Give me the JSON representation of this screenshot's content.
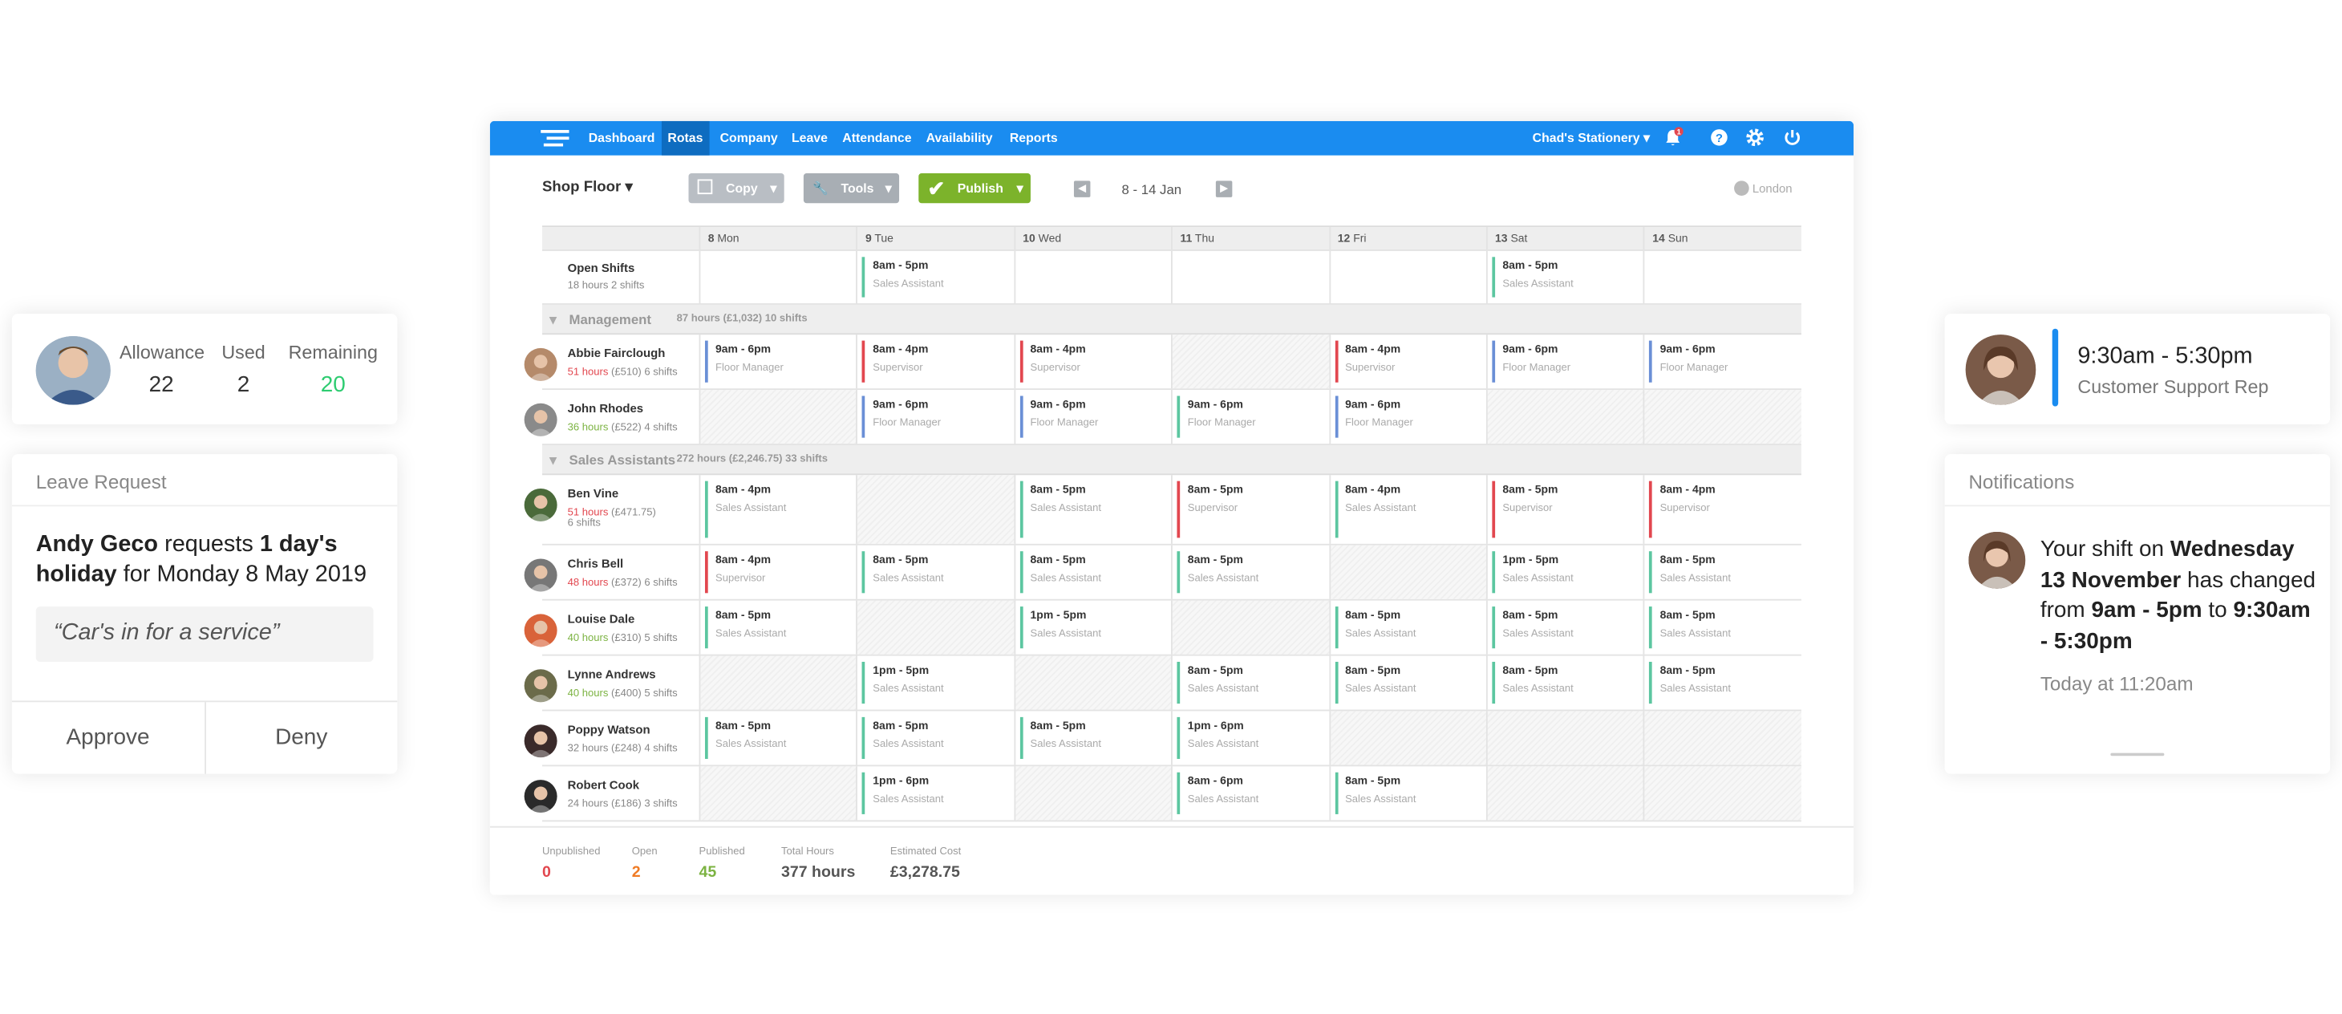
{
  "allowance": {
    "labels": [
      "Allowance",
      "Used",
      "Remaining"
    ],
    "values": [
      "22",
      "2",
      "20"
    ],
    "colors": [
      "#333",
      "#333",
      "#2ecc71"
    ]
  },
  "leave_request": {
    "title": "Leave Request",
    "name": "Andy Geco",
    "mid1": " requests ",
    "duration": "1 day's holiday",
    "mid2": " for Monday 8 May 2019",
    "note": "“Car's in for a service”",
    "approve": "Approve",
    "deny": "Deny"
  },
  "shift_card": {
    "time": "9:30am - 5:30pm",
    "role": "Customer Support Rep",
    "bar_color": "#1a8cf0"
  },
  "notifications": {
    "title": "Notifications",
    "p1": "Your shift on ",
    "b1": "Wednesday 13 November",
    "p2": " has changed from ",
    "b2": "9am - 5pm",
    "p3": " to ",
    "b3": "9:30am - 5:30pm",
    "time": "Today at 11:20am"
  },
  "nav": {
    "items": [
      "Dashboard",
      "Rotas",
      "Company",
      "Leave",
      "Attendance",
      "Availability",
      "Reports"
    ],
    "active": "Rotas",
    "company": "Chad's Stationery",
    "badge": "1",
    "icons": [
      "bell-icon",
      "help-icon",
      "gear-icon",
      "power-icon"
    ],
    "accent": "#1a8cf0"
  },
  "toolbar": {
    "location": "Shop Floor",
    "copy": "Copy",
    "tools": "Tools",
    "publish": "Publish",
    "range": "8 - 14 Jan",
    "timezone": "London"
  },
  "days": [
    {
      "n": "8",
      "d": "Mon"
    },
    {
      "n": "9",
      "d": "Tue"
    },
    {
      "n": "10",
      "d": "Wed"
    },
    {
      "n": "11",
      "d": "Thu"
    },
    {
      "n": "12",
      "d": "Fri"
    },
    {
      "n": "13",
      "d": "Sat"
    },
    {
      "n": "14",
      "d": "Sun"
    }
  ],
  "open_shifts": {
    "name": "Open Shifts",
    "hours": "18 hours",
    "shifts": "2 shifts",
    "cells": [
      null,
      {
        "t": "8am - 5pm",
        "r": "Sales Assistant",
        "c": "green"
      },
      null,
      null,
      null,
      {
        "t": "8am - 5pm",
        "r": "Sales Assistant",
        "c": "green"
      },
      null
    ]
  },
  "groups": [
    {
      "name": "Management",
      "meta": "87 hours (£1,032)",
      "shifts": "10 shifts",
      "employees": [
        {
          "name": "Abbie Fairclough",
          "hrs": "51 hours",
          "hc": "#e2474f",
          "cost": "(£510)",
          "shifts": "6 shifts",
          "avatar": "#b58a6a",
          "cells": [
            {
              "t": "9am - 6pm",
              "r": "Floor Manager",
              "c": "blue"
            },
            {
              "t": "8am - 4pm",
              "r": "Supervisor",
              "c": "red"
            },
            {
              "t": "8am - 4pm",
              "r": "Supervisor",
              "c": "red"
            },
            "h",
            {
              "t": "8am - 4pm",
              "r": "Supervisor",
              "c": "red"
            },
            {
              "t": "9am - 6pm",
              "r": "Floor Manager",
              "c": "blue"
            },
            {
              "t": "9am - 6pm",
              "r": "Floor Manager",
              "c": "blue"
            }
          ]
        },
        {
          "name": "John Rhodes",
          "hrs": "36 hours",
          "hc": "#7cb342",
          "cost": "(£522)",
          "shifts": "4 shifts",
          "avatar": "#8a8a8a",
          "cells": [
            "h",
            {
              "t": "9am - 6pm",
              "r": "Floor Manager",
              "c": "blue"
            },
            {
              "t": "9am - 6pm",
              "r": "Floor Manager",
              "c": "blue"
            },
            {
              "t": "9am - 6pm",
              "r": "Floor Manager",
              "c": "green"
            },
            {
              "t": "9am - 6pm",
              "r": "Floor Manager",
              "c": "blue"
            },
            "h",
            "h"
          ]
        }
      ]
    },
    {
      "name": "Sales Assistants",
      "meta": "272 hours (£2,246.75)",
      "shifts": "33 shifts",
      "employees": [
        {
          "name": "Ben Vine",
          "hrs": "51 hours",
          "hc": "#e2474f",
          "cost": "(£471.75)",
          "shifts": "6 shifts",
          "avatar": "#4a6a3a",
          "tall": true,
          "cells": [
            {
              "t": "8am - 4pm",
              "r": "Sales Assistant",
              "c": "green"
            },
            "h",
            {
              "t": "8am - 5pm",
              "r": "Sales Assistant",
              "c": "green"
            },
            {
              "t": "8am - 5pm",
              "r": "Supervisor",
              "c": "red"
            },
            {
              "t": "8am - 4pm",
              "r": "Sales Assistant",
              "c": "green"
            },
            {
              "t": "8am - 5pm",
              "r": "Supervisor",
              "c": "red"
            },
            {
              "t": "8am - 4pm",
              "r": "Supervisor",
              "c": "red"
            }
          ]
        },
        {
          "name": "Chris Bell",
          "hrs": "48 hours",
          "hc": "#e2474f",
          "cost": "(£372)",
          "shifts": "6 shifts",
          "avatar": "#777",
          "cells": [
            {
              "t": "8am - 4pm",
              "r": "Supervisor",
              "c": "red"
            },
            {
              "t": "8am - 5pm",
              "r": "Sales Assistant",
              "c": "green"
            },
            {
              "t": "8am - 5pm",
              "r": "Sales Assistant",
              "c": "green"
            },
            {
              "t": "8am - 5pm",
              "r": "Sales Assistant",
              "c": "green"
            },
            "h",
            {
              "t": "1pm - 5pm",
              "r": "Sales Assistant",
              "c": "green"
            },
            {
              "t": "8am - 5pm",
              "r": "Sales Assistant",
              "c": "green"
            }
          ]
        },
        {
          "name": "Louise Dale",
          "hrs": "40 hours",
          "hc": "#7cb342",
          "cost": "(£310)",
          "shifts": "5 shifts",
          "avatar": "#d9633a",
          "cells": [
            {
              "t": "8am - 5pm",
              "r": "Sales Assistant",
              "c": "green"
            },
            "h",
            {
              "t": "1pm - 5pm",
              "r": "Sales Assistant",
              "c": "green"
            },
            "h",
            {
              "t": "8am - 5pm",
              "r": "Sales Assistant",
              "c": "green"
            },
            {
              "t": "8am - 5pm",
              "r": "Sales Assistant",
              "c": "green"
            },
            {
              "t": "8am - 5pm",
              "r": "Sales Assistant",
              "c": "green"
            }
          ]
        },
        {
          "name": "Lynne Andrews",
          "hrs": "40 hours",
          "hc": "#7cb342",
          "cost": "(£400)",
          "shifts": "5 shifts",
          "avatar": "#6b6b4a",
          "cells": [
            "h",
            {
              "t": "1pm - 5pm",
              "r": "Sales Assistant",
              "c": "green"
            },
            "h",
            {
              "t": "8am - 5pm",
              "r": "Sales Assistant",
              "c": "green"
            },
            {
              "t": "8am - 5pm",
              "r": "Sales Assistant",
              "c": "green"
            },
            {
              "t": "8am - 5pm",
              "r": "Sales Assistant",
              "c": "green"
            },
            {
              "t": "8am - 5pm",
              "r": "Sales Assistant",
              "c": "green"
            }
          ]
        },
        {
          "name": "Poppy Watson",
          "hrs": "32 hours",
          "hc": "#888",
          "cost": "(£248)",
          "shifts": "4 shifts",
          "avatar": "#3a2a2a",
          "cells": [
            {
              "t": "8am - 5pm",
              "r": "Sales Assistant",
              "c": "green"
            },
            {
              "t": "8am - 5pm",
              "r": "Sales Assistant",
              "c": "green"
            },
            {
              "t": "8am - 5pm",
              "r": "Sales Assistant",
              "c": "green"
            },
            {
              "t": "1pm - 6pm",
              "r": "Sales Assistant",
              "c": "green"
            },
            "h",
            "h",
            "h"
          ]
        },
        {
          "name": "Robert Cook",
          "hrs": "24 hours",
          "hc": "#888",
          "cost": "(£186)",
          "shifts": "3 shifts",
          "avatar": "#2a2a2a",
          "cells": [
            "h",
            {
              "t": "1pm - 6pm",
              "r": "Sales Assistant",
              "c": "green"
            },
            "h",
            {
              "t": "8am - 6pm",
              "r": "Sales Assistant",
              "c": "green"
            },
            {
              "t": "8am - 5pm",
              "r": "Sales Assistant",
              "c": "green"
            },
            "h",
            "h"
          ]
        }
      ]
    }
  ],
  "footer": [
    {
      "label": "Unpublished",
      "value": "0",
      "color": "#e2474f"
    },
    {
      "label": "Open",
      "value": "2",
      "color": "#f07b24"
    },
    {
      "label": "Published",
      "value": "45",
      "color": "#7cb342"
    },
    {
      "label": "Total Hours",
      "value": "377 hours",
      "color": "#555"
    },
    {
      "label": "Estimated Cost",
      "value": "£3,278.75",
      "color": "#555"
    }
  ]
}
